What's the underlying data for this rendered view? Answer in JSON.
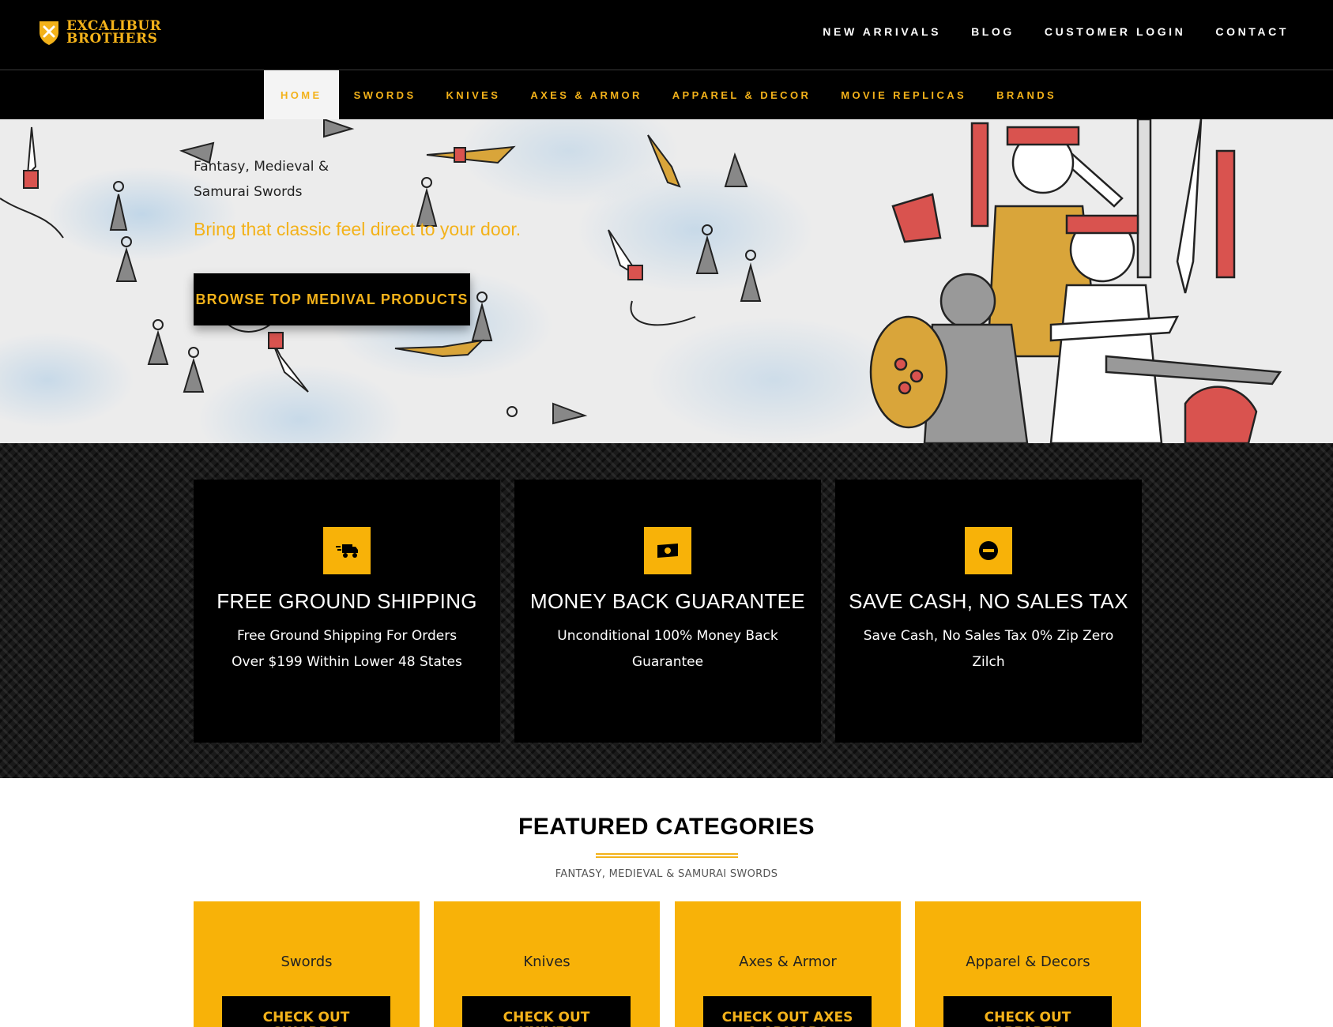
{
  "brand": {
    "line1": "EXCALIBUR",
    "line2": "BROTHERS",
    "accent": "#f3b21a"
  },
  "top_nav": [
    {
      "label": "NEW ARRIVALS"
    },
    {
      "label": "BLOG"
    },
    {
      "label": "CUSTOMER LOGIN"
    },
    {
      "label": "CONTACT"
    }
  ],
  "cat_nav": [
    {
      "label": "HOME",
      "active": true
    },
    {
      "label": "SWORDS"
    },
    {
      "label": "KNIVES"
    },
    {
      "label": "AXES & ARMOR"
    },
    {
      "label": "APPAREL & DECOR"
    },
    {
      "label": "MOVIE REPLICAS"
    },
    {
      "label": "BRANDS"
    }
  ],
  "hero": {
    "subtitle": "Fantasy, Medieval & Samurai Swords",
    "tagline": "Bring that classic feel direct to your door.",
    "cta": "BROWSE TOP MEDIVAL PRODUCTS"
  },
  "features": [
    {
      "icon": "truck-icon",
      "title": "FREE GROUND SHIPPING",
      "text": "Free Ground Shipping For Orders Over $199 Within Lower 48 States"
    },
    {
      "icon": "money-icon",
      "title": "MONEY BACK GUARANTEE",
      "text": "Unconditional 100% Money Back Guarantee"
    },
    {
      "icon": "no-entry-icon",
      "title": "SAVE CASH, NO SALES TAX",
      "text": "Save Cash, No Sales Tax 0% Zip Zero Zilch"
    }
  ],
  "featured": {
    "title": "FEATURED CATEGORIES",
    "subtitle": "FANTASY, MEDIEVAL & SAMURAI SWORDS",
    "cards": [
      {
        "name": "Swords",
        "button": "CHECK OUT SWORDS"
      },
      {
        "name": "Knives",
        "button": "CHECK OUT KNIVES"
      },
      {
        "name": "Axes & Armor",
        "button": "CHECK OUT AXES & ARMORS"
      },
      {
        "name": "Apparel & Decors",
        "button": "CHECK OUT APPAREL"
      }
    ]
  }
}
